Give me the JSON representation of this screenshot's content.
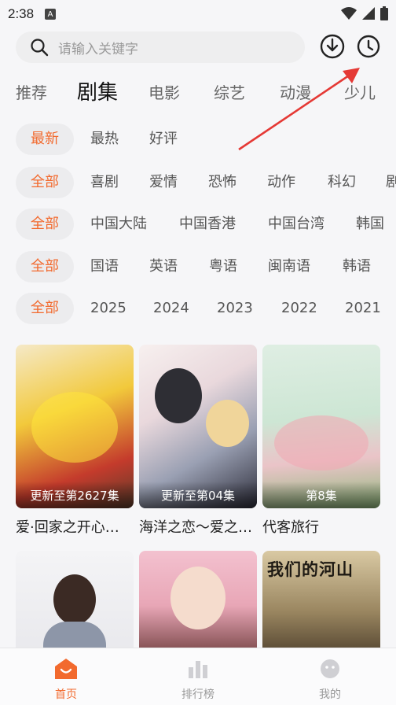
{
  "status_bar": {
    "time": "2:38",
    "notification_icon": "A"
  },
  "search": {
    "placeholder": "请输入关键字"
  },
  "tabs": [
    {
      "label": "推荐"
    },
    {
      "label": "剧集"
    },
    {
      "label": "电影"
    },
    {
      "label": "综艺"
    },
    {
      "label": "动漫"
    },
    {
      "label": "少儿"
    }
  ],
  "filters": {
    "sort": [
      "最新",
      "最热",
      "好评"
    ],
    "genre": [
      "全部",
      "喜剧",
      "爱情",
      "恐怖",
      "动作",
      "科幻",
      "剧"
    ],
    "region": [
      "全部",
      "中国大陆",
      "中国香港",
      "中国台湾",
      "韩国"
    ],
    "language": [
      "全部",
      "国语",
      "英语",
      "粤语",
      "闽南语",
      "韩语"
    ],
    "year": [
      "全部",
      "2025",
      "2024",
      "2023",
      "2022",
      "2021"
    ]
  },
  "items": [
    {
      "title": "爱·回家之开心…",
      "badge": "更新至第2627集"
    },
    {
      "title": "海洋之恋～爱之…",
      "badge": "更新至第04集"
    },
    {
      "title": "代客旅行",
      "badge": "第8集"
    },
    {
      "title": "",
      "badge": ""
    },
    {
      "title": "",
      "badge": ""
    },
    {
      "title": "",
      "badge": ""
    }
  ],
  "poster_text": {
    "p6": "我们的河山"
  },
  "bottom_nav": [
    {
      "label": "首页"
    },
    {
      "label": "排行榜"
    },
    {
      "label": "我的"
    }
  ],
  "colors": {
    "accent": "#f26a2e",
    "annotation_arrow": "#e53935"
  }
}
